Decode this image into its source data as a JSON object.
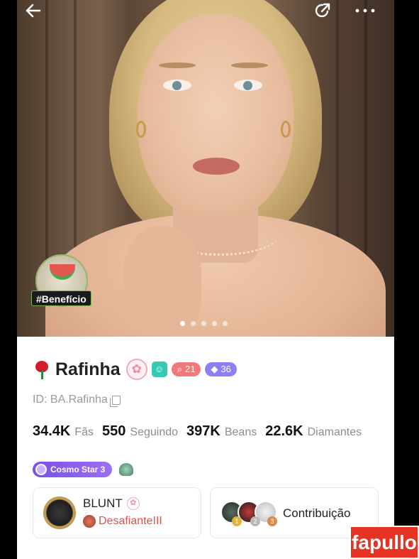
{
  "header": {
    "back_icon": "arrow-left-icon",
    "share_icon": "share-icon",
    "more_icon": "more-dots-icon"
  },
  "hero": {
    "benefit_label": "#Benefício",
    "carousel_pages": 5,
    "carousel_active_index": 0
  },
  "profile": {
    "name": "Rafinha",
    "level_red": "21",
    "level_purple": "36",
    "id_text": "ID: BA.Rafinha",
    "stats": [
      {
        "value": "34.4K",
        "label": "Fãs"
      },
      {
        "value": "550",
        "label": "Seguindo"
      },
      {
        "value": "397K",
        "label": "Beans"
      },
      {
        "value": "22.6K",
        "label": "Diamantes"
      }
    ],
    "cosmo_badge": "Cosmo Star 3"
  },
  "family": {
    "name": "BLUNT",
    "rank": "DesafianteIII"
  },
  "contribution": {
    "label": "Contribuição",
    "medals": [
      "1",
      "2",
      "3"
    ]
  },
  "watermark": {
    "text": "fapullo"
  },
  "colors": {
    "accent_purple": "#8c7ef3",
    "accent_red": "#f07a7a",
    "accent_teal": "#35c9b3",
    "rank_red": "#d9534f",
    "watermark_red": "#e63323"
  }
}
